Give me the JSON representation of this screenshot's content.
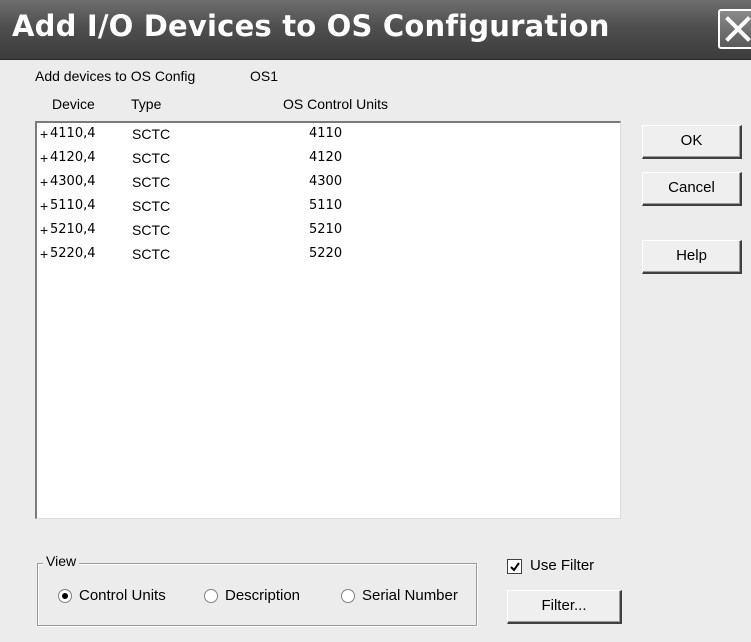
{
  "window": {
    "title": "Add I/O Devices to OS Configuration"
  },
  "info": {
    "add_label": "Add devices to OS Config",
    "os_name": "OS1"
  },
  "columns": {
    "device": "Device",
    "type": "Type",
    "cu": "OS Control Units"
  },
  "rows": [
    {
      "expander": "+",
      "device": "4110,4",
      "type": "SCTC",
      "cu": "4110"
    },
    {
      "expander": "+",
      "device": "4120,4",
      "type": "SCTC",
      "cu": "4120"
    },
    {
      "expander": "+",
      "device": "4300,4",
      "type": "SCTC",
      "cu": "4300"
    },
    {
      "expander": "+",
      "device": "5110,4",
      "type": "SCTC",
      "cu": "5110"
    },
    {
      "expander": "+",
      "device": "5210,4",
      "type": "SCTC",
      "cu": "5210"
    },
    {
      "expander": "+",
      "device": "5220,4",
      "type": "SCTC",
      "cu": "5220"
    }
  ],
  "buttons": {
    "ok": "OK",
    "cancel": "Cancel",
    "help": "Help",
    "filter": "Filter..."
  },
  "view": {
    "legend": "View",
    "options": [
      "Control Units",
      "Description",
      "Serial Number"
    ],
    "selected": "Control Units"
  },
  "use_filter": {
    "label": "Use Filter",
    "checked": true
  },
  "icons": {
    "close": "close-icon",
    "checkmark": "checkmark-icon"
  }
}
